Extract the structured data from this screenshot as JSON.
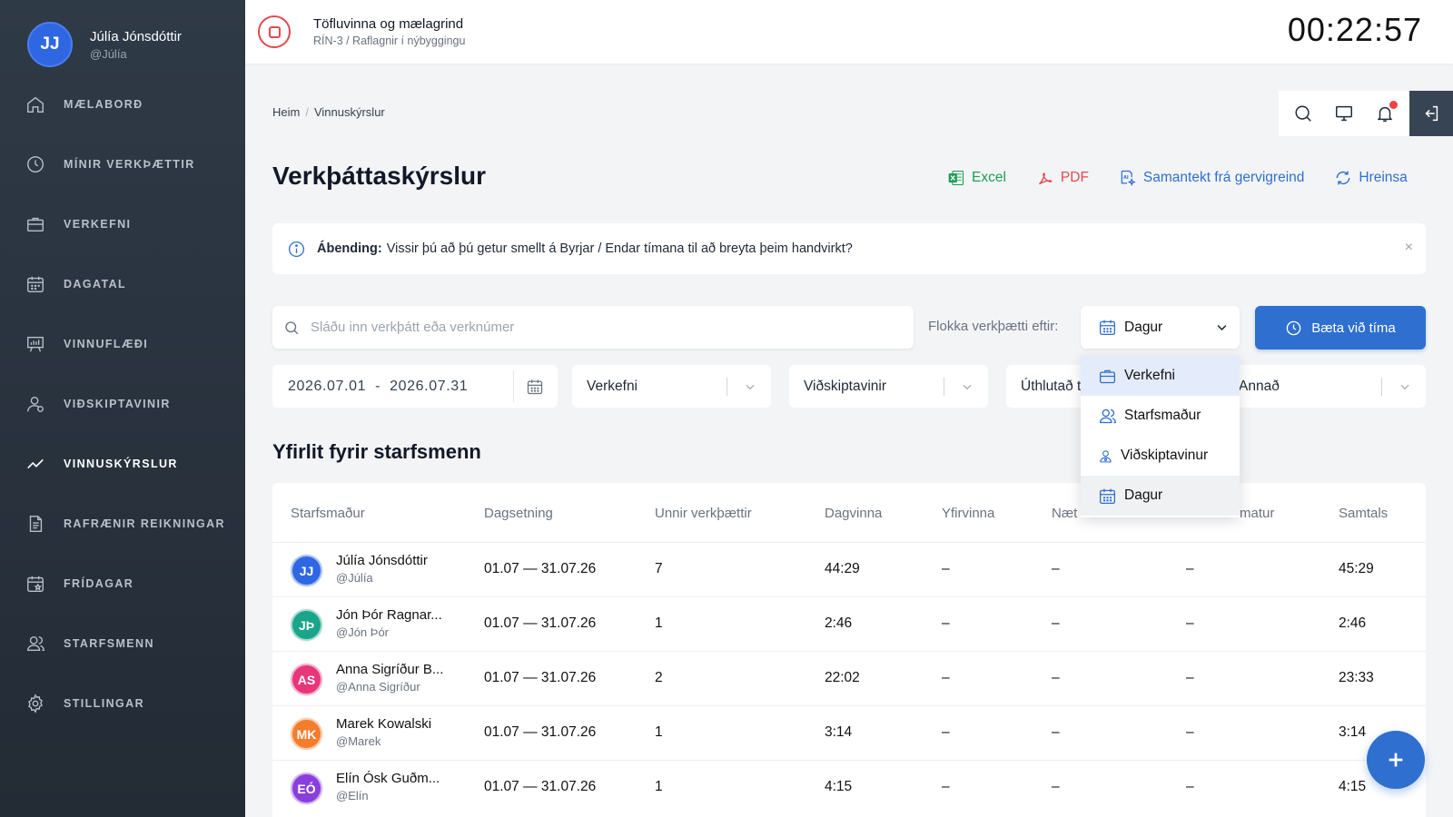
{
  "user": {
    "initials": "JJ",
    "name": "Júlía Jónsdóttir",
    "handle": "@Júlía"
  },
  "nav": [
    {
      "label": "MÆLABORÐ",
      "icon": "home-icon"
    },
    {
      "label": "MÍNIR VERKÞÆTTIR",
      "icon": "clock-icon"
    },
    {
      "label": "VERKEFNI",
      "icon": "briefcase-icon"
    },
    {
      "label": "DAGATAL",
      "icon": "calendar-icon"
    },
    {
      "label": "VINNUFLÆÐI",
      "icon": "presentation-icon"
    },
    {
      "label": "VIÐSKIPTAVINIR",
      "icon": "user-icon"
    },
    {
      "label": "VINNUSKÝRSLUR",
      "icon": "trend-line-icon",
      "active": true
    },
    {
      "label": "RAFRÆNIR REIKNINGAR",
      "icon": "document-icon"
    },
    {
      "label": "FRÍDAGAR",
      "icon": "calendar-star-icon"
    },
    {
      "label": "STARFSMENN",
      "icon": "users-icon"
    },
    {
      "label": "STILLINGAR",
      "icon": "gear-icon"
    }
  ],
  "topbar": {
    "project_title": "Töfluvinna og mælagrind",
    "project_sub": "RÍN-3 / Raflagnir í nýbyggingu",
    "timer": "00:22:57"
  },
  "breadcrumb": {
    "home": "Heim",
    "current": "Vinnuskýrslur"
  },
  "page": {
    "title": "Verkþáttaskýrslur"
  },
  "actions": {
    "excel": "Excel",
    "pdf": "PDF",
    "ai": "Samantekt frá gervigreind",
    "reset": "Hreinsa"
  },
  "actions_colors": {
    "excel": "#1f9d55",
    "pdf": "#e5484d",
    "link": "#2f6fd0"
  },
  "tip": {
    "label": "Ábending:",
    "text": "Vissir þú að þú getur smellt á Byrjar / Endar tímana til að breyta þeim handvirkt?",
    "close": "×"
  },
  "search": {
    "placeholder": "Sláðu inn verkþátt eða verknúmer",
    "value": ""
  },
  "group_by": {
    "label": "Flokka verkþætti eftir:",
    "selected": "Dagur"
  },
  "add_button": "Bæta við tíma",
  "filters": {
    "date_range": "2026.07.01  -  2026.07.31",
    "project": "Verkefni",
    "client": "Viðskiptavinir",
    "assigned": "Úthlutað t",
    "other": "Annað"
  },
  "dropdown": {
    "options": [
      "Verkefni",
      "Starfsmaður",
      "Viðskiptavinur",
      "Dagur"
    ]
  },
  "section": {
    "title": "Yfirlit fyrir starfsmenn"
  },
  "table": {
    "headers": [
      "Starfsmaður",
      "Dagsetning",
      "Unnir verkþættir",
      "Dagvinna",
      "Yfirvinna",
      "Næt",
      "matur",
      "Samtals"
    ],
    "rows": [
      {
        "initials": "JJ",
        "color": "#2f67e3",
        "name": "Júlía Jónsdóttir",
        "handle": "@Júlía",
        "date": "01.07 — 31.07.26",
        "tasks": "7",
        "day": "44:29",
        "over": "–",
        "night": "–",
        "food": "–",
        "total": "45:29"
      },
      {
        "initials": "JÞ",
        "color": "#1aa58a",
        "name": "Jón Þór Ragnar...",
        "handle": "@Jón Þór",
        "date": "01.07 — 31.07.26",
        "tasks": "1",
        "day": "2:46",
        "over": "–",
        "night": "–",
        "food": "–",
        "total": "2:46"
      },
      {
        "initials": "AS",
        "color": "#e8367a",
        "name": "Anna Sigríður B...",
        "handle": "@Anna Sigríður",
        "date": "01.07 — 31.07.26",
        "tasks": "2",
        "day": "22:02",
        "over": "–",
        "night": "–",
        "food": "–",
        "total": "23:33"
      },
      {
        "initials": "MK",
        "color": "#f47c2c",
        "name": "Marek Kowalski",
        "handle": "@Marek",
        "date": "01.07 — 31.07.26",
        "tasks": "1",
        "day": "3:14",
        "over": "–",
        "night": "–",
        "food": "–",
        "total": "3:14"
      },
      {
        "initials": "EÓ",
        "color": "#8a3fdc",
        "name": "Elín Ósk Guðm...",
        "handle": "@Elín",
        "date": "01.07 — 31.07.26",
        "tasks": "1",
        "day": "4:15",
        "over": "–",
        "night": "–",
        "food": "–",
        "total": "4:15"
      }
    ]
  }
}
